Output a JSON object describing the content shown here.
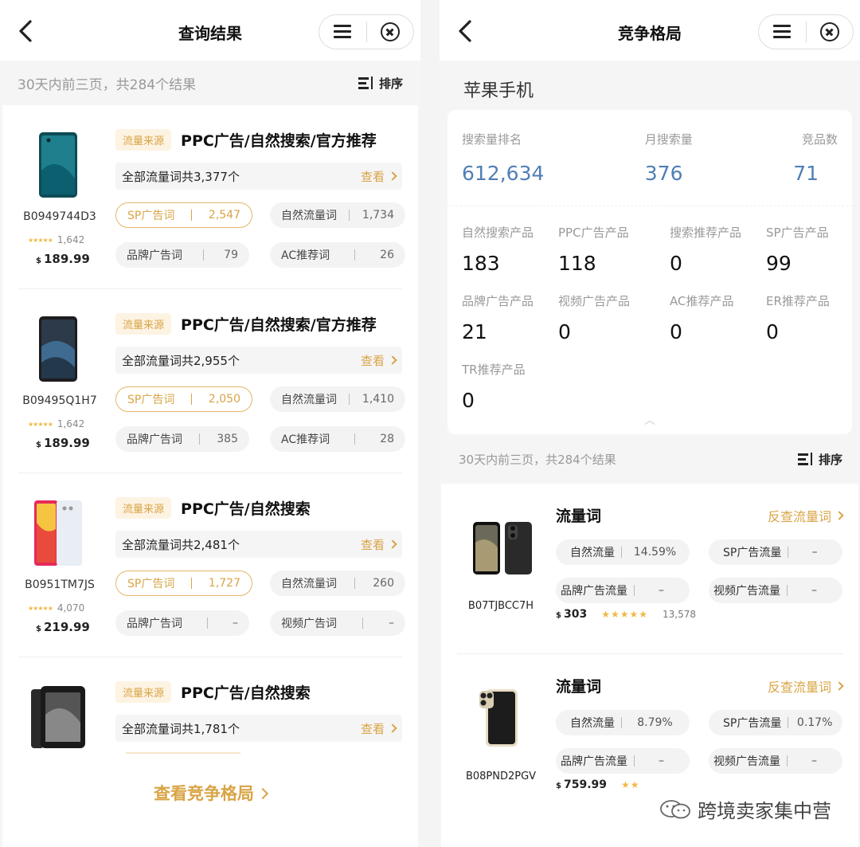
{
  "left": {
    "title": "查询结果",
    "summary": "30天内前三页，共284个结果",
    "sort_label": "排序",
    "products": [
      {
        "asin": "B0949744D3",
        "reviews": "1,642",
        "price": "189.99",
        "source_tag": "流量来源",
        "source_text": "PPC广告/自然搜索/官方推荐",
        "total": "全部流量词共3,377个",
        "view": "查看",
        "pills": [
          {
            "label": "SP广告词",
            "value": "2,547"
          },
          {
            "label": "自然流量词",
            "value": "1,734"
          },
          {
            "label": "品牌广告词",
            "value": "79"
          },
          {
            "label": "AC推荐词",
            "value": "26"
          }
        ]
      },
      {
        "asin": "B09495Q1H7",
        "reviews": "1,642",
        "price": "189.99",
        "source_tag": "流量来源",
        "source_text": "PPC广告/自然搜索/官方推荐",
        "total": "全部流量词共2,955个",
        "view": "查看",
        "pills": [
          {
            "label": "SP广告词",
            "value": "2,050"
          },
          {
            "label": "自然流量词",
            "value": "1,410"
          },
          {
            "label": "品牌广告词",
            "value": "385"
          },
          {
            "label": "AC推荐词",
            "value": "28"
          }
        ]
      },
      {
        "asin": "B0951TM7JS",
        "reviews": "4,070",
        "price": "219.99",
        "source_tag": "流量来源",
        "source_text": "PPC广告/自然搜索",
        "total": "全部流量词共2,481个",
        "view": "查看",
        "pills": [
          {
            "label": "SP广告词",
            "value": "1,727"
          },
          {
            "label": "自然流量词",
            "value": "260"
          },
          {
            "label": "品牌广告词",
            "value": "–"
          },
          {
            "label": "视频广告词",
            "value": "–"
          }
        ]
      },
      {
        "source_tag": "流量来源",
        "source_text": "PPC广告/自然搜索",
        "total": "全部流量词共1,781个",
        "view": "查看"
      }
    ],
    "bottom_link": "查看竞争格局"
  },
  "right": {
    "title": "竞争格局",
    "keyword": "苹果手机",
    "top_stats": [
      {
        "label": "搜索量排名",
        "value": "612,634"
      },
      {
        "label": "月搜索量",
        "value": "376"
      },
      {
        "label": "竞品数",
        "value": "71"
      }
    ],
    "grid_stats": [
      {
        "label": "自然搜索产品",
        "value": "183"
      },
      {
        "label": "PPC广告产品",
        "value": "118"
      },
      {
        "label": "搜索推荐产品",
        "value": "0"
      },
      {
        "label": "SP广告产品",
        "value": "99"
      },
      {
        "label": "品牌广告产品",
        "value": "21"
      },
      {
        "label": "视频广告产品",
        "value": "0"
      },
      {
        "label": "AC推荐产品",
        "value": "0"
      },
      {
        "label": "ER推荐产品",
        "value": "0"
      },
      {
        "label": "TR推荐产品",
        "value": "0"
      }
    ],
    "summary": "30天内前三页，共284个结果",
    "sort_label": "排序",
    "products": [
      {
        "asin": "B07TJBCC7H",
        "heading": "流量词",
        "reverse": "反查流量词",
        "price": "303",
        "reviews": "13,578",
        "pills": [
          {
            "label": "自然流量",
            "value": "14.59%"
          },
          {
            "label": "SP广告流量",
            "value": "–"
          },
          {
            "label": "品牌广告流量",
            "value": "–"
          },
          {
            "label": "视频广告流量",
            "value": "–"
          }
        ]
      },
      {
        "asin": "B08PND2PGV",
        "heading": "流量词",
        "reverse": "反查流量词",
        "price": "759.99",
        "pills": [
          {
            "label": "自然流量",
            "value": "8.79%"
          },
          {
            "label": "SP广告流量",
            "value": "0.17%"
          },
          {
            "label": "品牌广告流量",
            "value": "–"
          },
          {
            "label": "视频广告流量",
            "value": "–"
          }
        ]
      }
    ]
  },
  "watermark": "跨境卖家集中营",
  "colors": {
    "accent": "#d9a446",
    "stat_blue": "#4f7fb5"
  }
}
